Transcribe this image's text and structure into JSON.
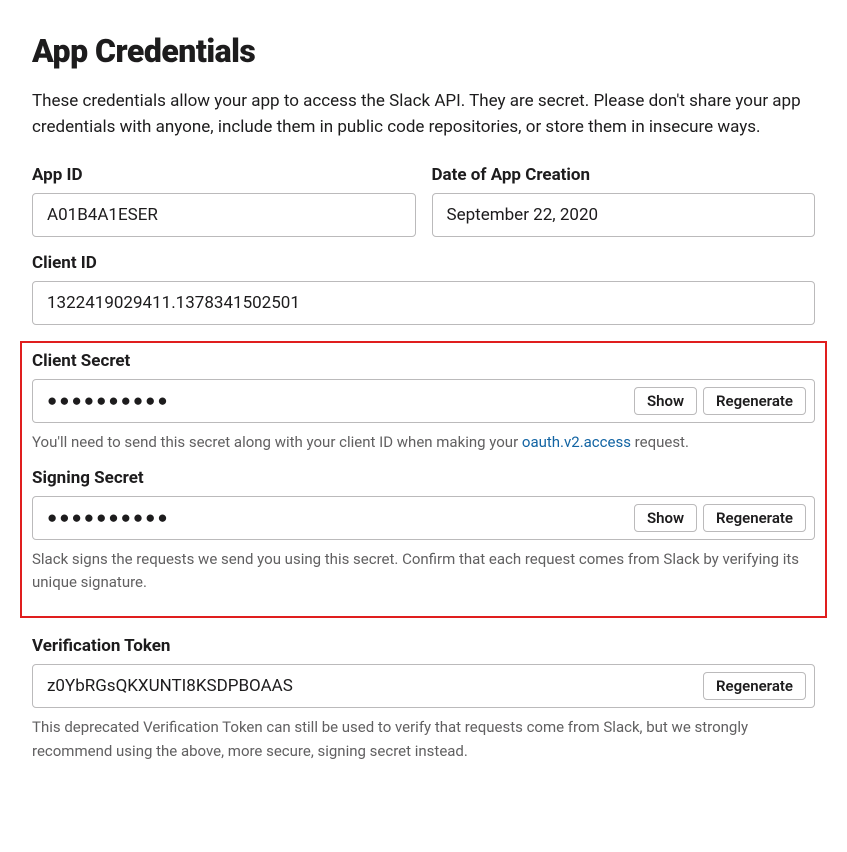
{
  "header": {
    "title": "App Credentials",
    "description": "These credentials allow your app to access the Slack API. They are secret. Please don't share your app credentials with anyone, include them in public code repositories, or store them in insecure ways."
  },
  "appId": {
    "label": "App ID",
    "value": "A01B4A1ESER"
  },
  "dateCreated": {
    "label": "Date of App Creation",
    "value": "September 22, 2020"
  },
  "clientId": {
    "label": "Client ID",
    "value": "1322419029411.1378341502501"
  },
  "clientSecret": {
    "label": "Client Secret",
    "masked": "●●●●●●●●●●",
    "showButton": "Show",
    "regenerateButton": "Regenerate",
    "helpPrefix": "You'll need to send this secret along with your client ID when making your ",
    "helpLink": "oauth.v2.access",
    "helpSuffix": " request."
  },
  "signingSecret": {
    "label": "Signing Secret",
    "masked": "●●●●●●●●●●",
    "showButton": "Show",
    "regenerateButton": "Regenerate",
    "help": "Slack signs the requests we send you using this secret. Confirm that each request comes from Slack by verifying its unique signature."
  },
  "verificationToken": {
    "label": "Verification Token",
    "value": "z0YbRGsQKXUNTI8KSDPBOAAS",
    "regenerateButton": "Regenerate",
    "help": "This deprecated Verification Token can still be used to verify that requests come from Slack, but we strongly recommend using the above, more secure, signing secret instead."
  }
}
